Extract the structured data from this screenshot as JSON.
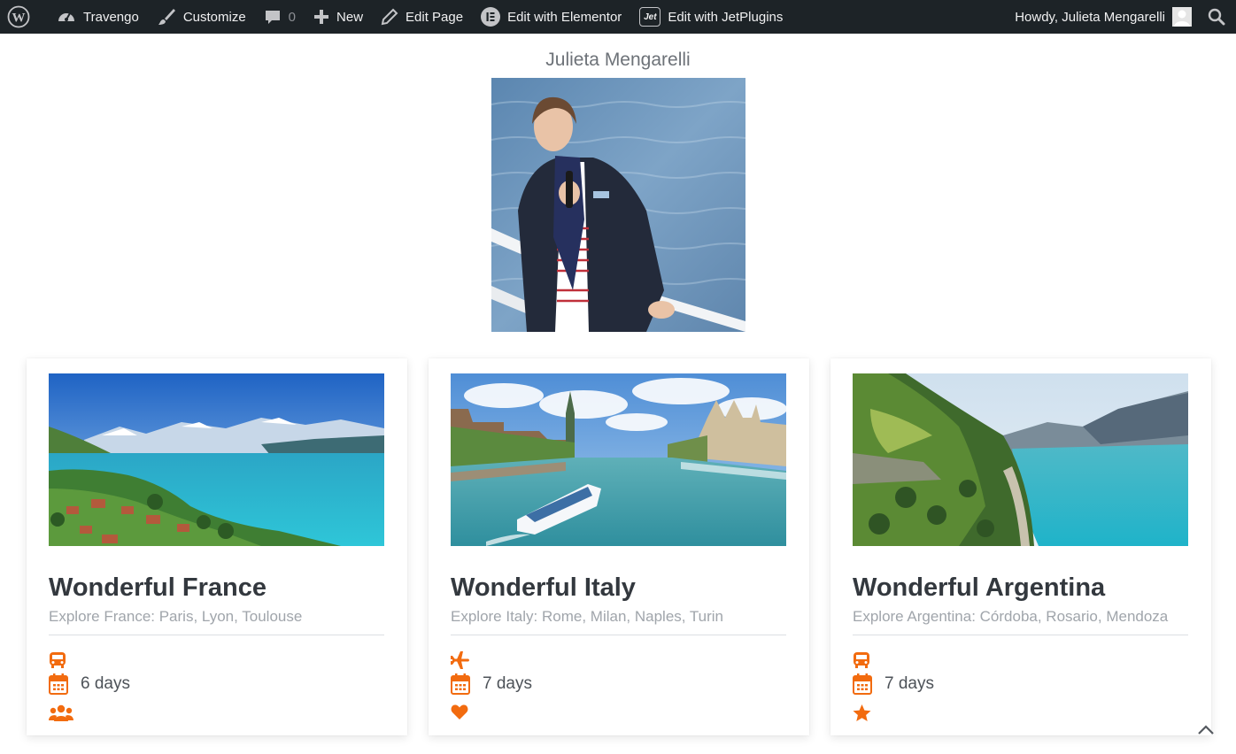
{
  "adminbar": {
    "site_name": "Travengo",
    "customize": "Customize",
    "comments_count": "0",
    "new": "New",
    "edit_page": "Edit Page",
    "edit_elementor": "Edit with Elementor",
    "jet_badge": "Jet",
    "edit_jetplugins": "Edit with JetPlugins",
    "howdy": "Howdy, Julieta Mengarelli"
  },
  "profile": {
    "name": "Julieta Mengarelli"
  },
  "colors": {
    "accent": "#f26b0f",
    "adminbar_bg": "#1d2327"
  },
  "tours": [
    {
      "title": "Wonderful France",
      "subtitle": "Explore France: Paris, Lyon, Toulouse",
      "transport_icon": "bus-icon",
      "days": "6 days",
      "extra_icon": "users-icon"
    },
    {
      "title": "Wonderful Italy",
      "subtitle": "Explore Italy: Rome, Milan, Naples, Turin",
      "transport_icon": "plane-icon",
      "days": "7 days",
      "extra_icon": "heart-icon"
    },
    {
      "title": "Wonderful Argentina",
      "subtitle": "Explore Argentina: Córdoba, Rosario, Mendoza",
      "transport_icon": "bus-icon",
      "days": "7 days",
      "extra_icon": "star-icon"
    }
  ]
}
